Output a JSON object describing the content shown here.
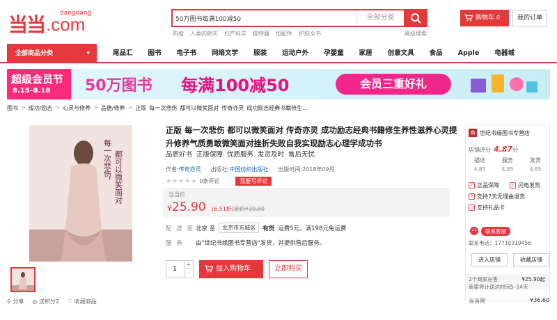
{
  "header": {
    "logo_mark": "当当",
    "logo_sub": "dangdang",
    "logo_big": ".com",
    "search_value": "50万图书每满100减50",
    "search_category": "全部分类",
    "hot_words": [
      "热搜",
      "人类的明天",
      "妇产科学",
      "疫特疆",
      "加配件",
      "护肤全书"
    ],
    "advanced_search": "高级搜索",
    "cart_label": "购物车 0",
    "orders_label": "我的订单"
  },
  "nav": {
    "all_categories": "全部商品分类",
    "items": [
      "尾品汇",
      "图书",
      "电子书",
      "网络文学",
      "服装",
      "运动户外",
      "孕婴童",
      "家居",
      "创意文具",
      "食品",
      "Apple",
      "电器城"
    ]
  },
  "banner": {
    "tag_title": "超级会员节",
    "tag_dates": "8.15–8.18",
    "m1": "50万图书",
    "m2": "每满100减50",
    "m3": "会员三重好礼"
  },
  "breadcrumb": [
    "图书",
    "成功/励志",
    "心灵与修养",
    "品德/修养",
    "正版",
    "每一次悲伤",
    "都可以微笑面对",
    "传奇亦灵",
    "成功励志经典书籍修生..."
  ],
  "product": {
    "cover_line1": "每一次悲伤，",
    "cover_line2": "都可以微笑面对",
    "title": "正版 每一次悲伤 都可以微笑面对 传奇亦灵 成功励志经典书籍修生养性滋养心灵提升修养气质勇敢微笑面对挫折失败自我实现励志心理学成功书",
    "slogan": [
      "品质好书",
      "正版保障",
      "优质服务",
      "发货及时",
      "售后无忧"
    ],
    "author_label": "作者:",
    "author": "传奇亦灵",
    "publisher_label": "出版社:",
    "publisher": "中国纺织出版社",
    "pub_time_label": "出版时间:",
    "pub_time": "2018年09月",
    "review_count": "0条评论",
    "review_button": "我要写评论",
    "price_label": "当当价",
    "price_symbol": "¥",
    "price": "25.90",
    "discount": "(6.51折)",
    "original_price": "定价¥39.80",
    "ship_label": "配 送 至",
    "ship_from": "北京 至",
    "ship_to": "北京市东城区",
    "ship_stock": "有货",
    "ship_fee": "运费5元，满198元免运费",
    "service_label": "服 务",
    "service_text": "由\"世纪书缘图书专营店\"发货，并提供售后服务。",
    "qty": "1",
    "qty_plus": "+",
    "qty_minus": "−",
    "add_cart": "加入购物车",
    "buy_now": "立即购买",
    "share": "分享",
    "gift": "送积分2",
    "favorite": "收藏商品"
  },
  "store": {
    "icon": "商",
    "name": "世纪书缘图书专营店",
    "score_label": "店铺评分",
    "score": "4.87",
    "score_unit": "分",
    "cols": [
      {
        "k": "描述",
        "v": "4.85"
      },
      {
        "k": "服务",
        "v": "4.85"
      },
      {
        "k": "发货",
        "v": "4.85"
      }
    ],
    "features": [
      "正品保障",
      "闪电发货",
      "支持7天无理由退货",
      "支持礼品卡"
    ],
    "contact": "联系客服",
    "phone": "联系电话：17710319456",
    "enter_store": "进入店铺",
    "fav_store": "收藏店铺",
    "alt_title": "2个商家在售",
    "alt_price": "¥25.90起",
    "alt_note": "商家将计送达时间5–14天",
    "alt2_label": "当当网",
    "alt2_price": "¥36.60"
  },
  "colors": {
    "accent": "#e4393c",
    "banner_pink": "#f0268a",
    "link": "#1a66b3"
  }
}
